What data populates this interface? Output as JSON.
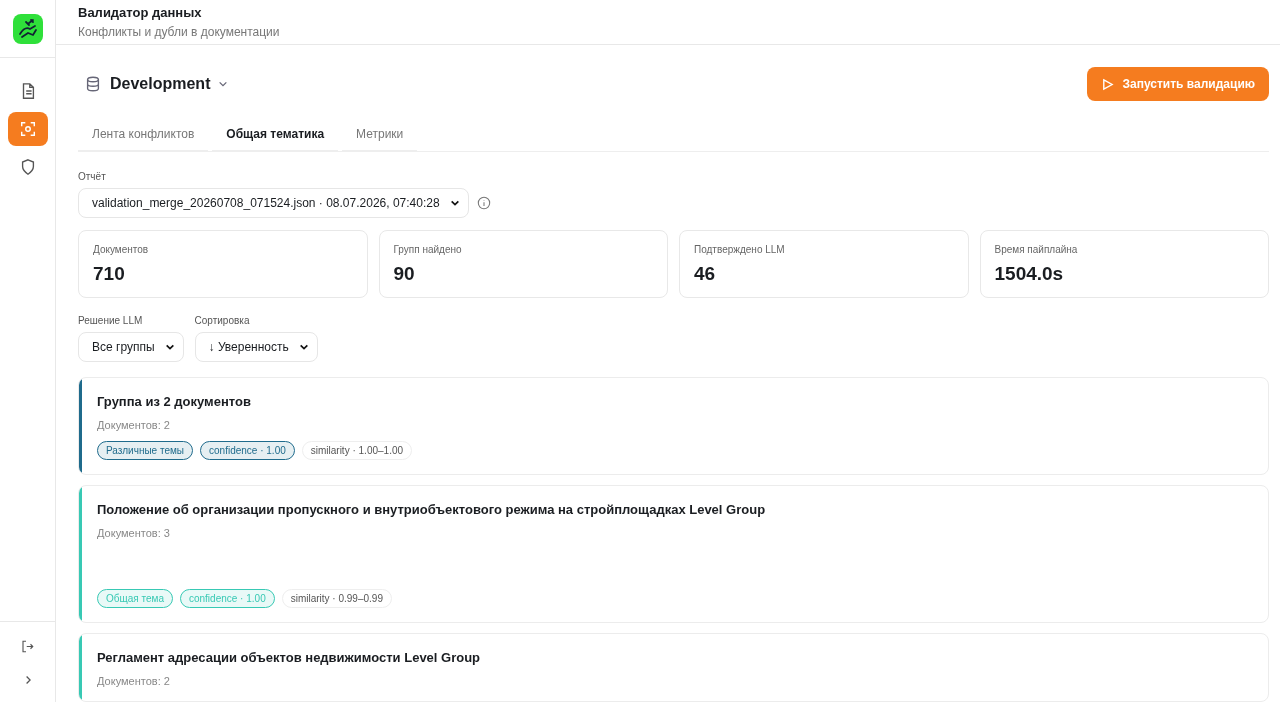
{
  "header": {
    "title": "Валидатор данных",
    "subtitle": "Конфликты и дубли в документации"
  },
  "sidebar": {
    "items": [
      {
        "selected": false
      },
      {
        "selected": true
      },
      {
        "selected": false
      }
    ]
  },
  "environment": {
    "name": "Development"
  },
  "run_button": {
    "label": "Запустить валидацию"
  },
  "tabs": [
    {
      "label": "Лента конфликтов",
      "selected": false
    },
    {
      "label": "Общая тематика",
      "selected": true
    },
    {
      "label": "Метрики",
      "selected": false
    }
  ],
  "report": {
    "label": "Отчёт",
    "value": "validation_merge_20260708_071524.json · 08.07.2026, 07:40:28"
  },
  "stats": [
    {
      "label": "Документов",
      "value": "710"
    },
    {
      "label": "Групп найдено",
      "value": "90"
    },
    {
      "label": "Подтверждено LLM",
      "value": "46"
    },
    {
      "label": "Время пайплайна",
      "value": "1504.0s"
    }
  ],
  "filters": [
    {
      "label": "Решение LLM",
      "value": "Все группы"
    },
    {
      "label": "Сортировка",
      "value": "↓ Уверенность"
    }
  ],
  "groups": [
    {
      "title": "Группа из 2 документов",
      "count": "Документов: 2",
      "color": "#1f6b8c",
      "tags": [
        {
          "text": "Различные темы",
          "kind": "accent"
        },
        {
          "text": "confidence · 1.00",
          "kind": "accent"
        },
        {
          "text": "similarity · 1.00–1.00",
          "kind": "plain"
        }
      ]
    },
    {
      "title": "Положение об организации пропускного и внутриобъектового режима на стройплощадках Level Group",
      "count": "Документов: 3",
      "color": "#38c9b4",
      "tags": [
        {
          "text": "Общая тема",
          "kind": "accent"
        },
        {
          "text": "confidence · 1.00",
          "kind": "accent"
        },
        {
          "text": "similarity · 0.99–0.99",
          "kind": "plain"
        }
      ]
    },
    {
      "title": "Регламент адресации объектов недвижимости Level Group",
      "count": "Документов: 2",
      "color": "#38c9b4"
    }
  ]
}
